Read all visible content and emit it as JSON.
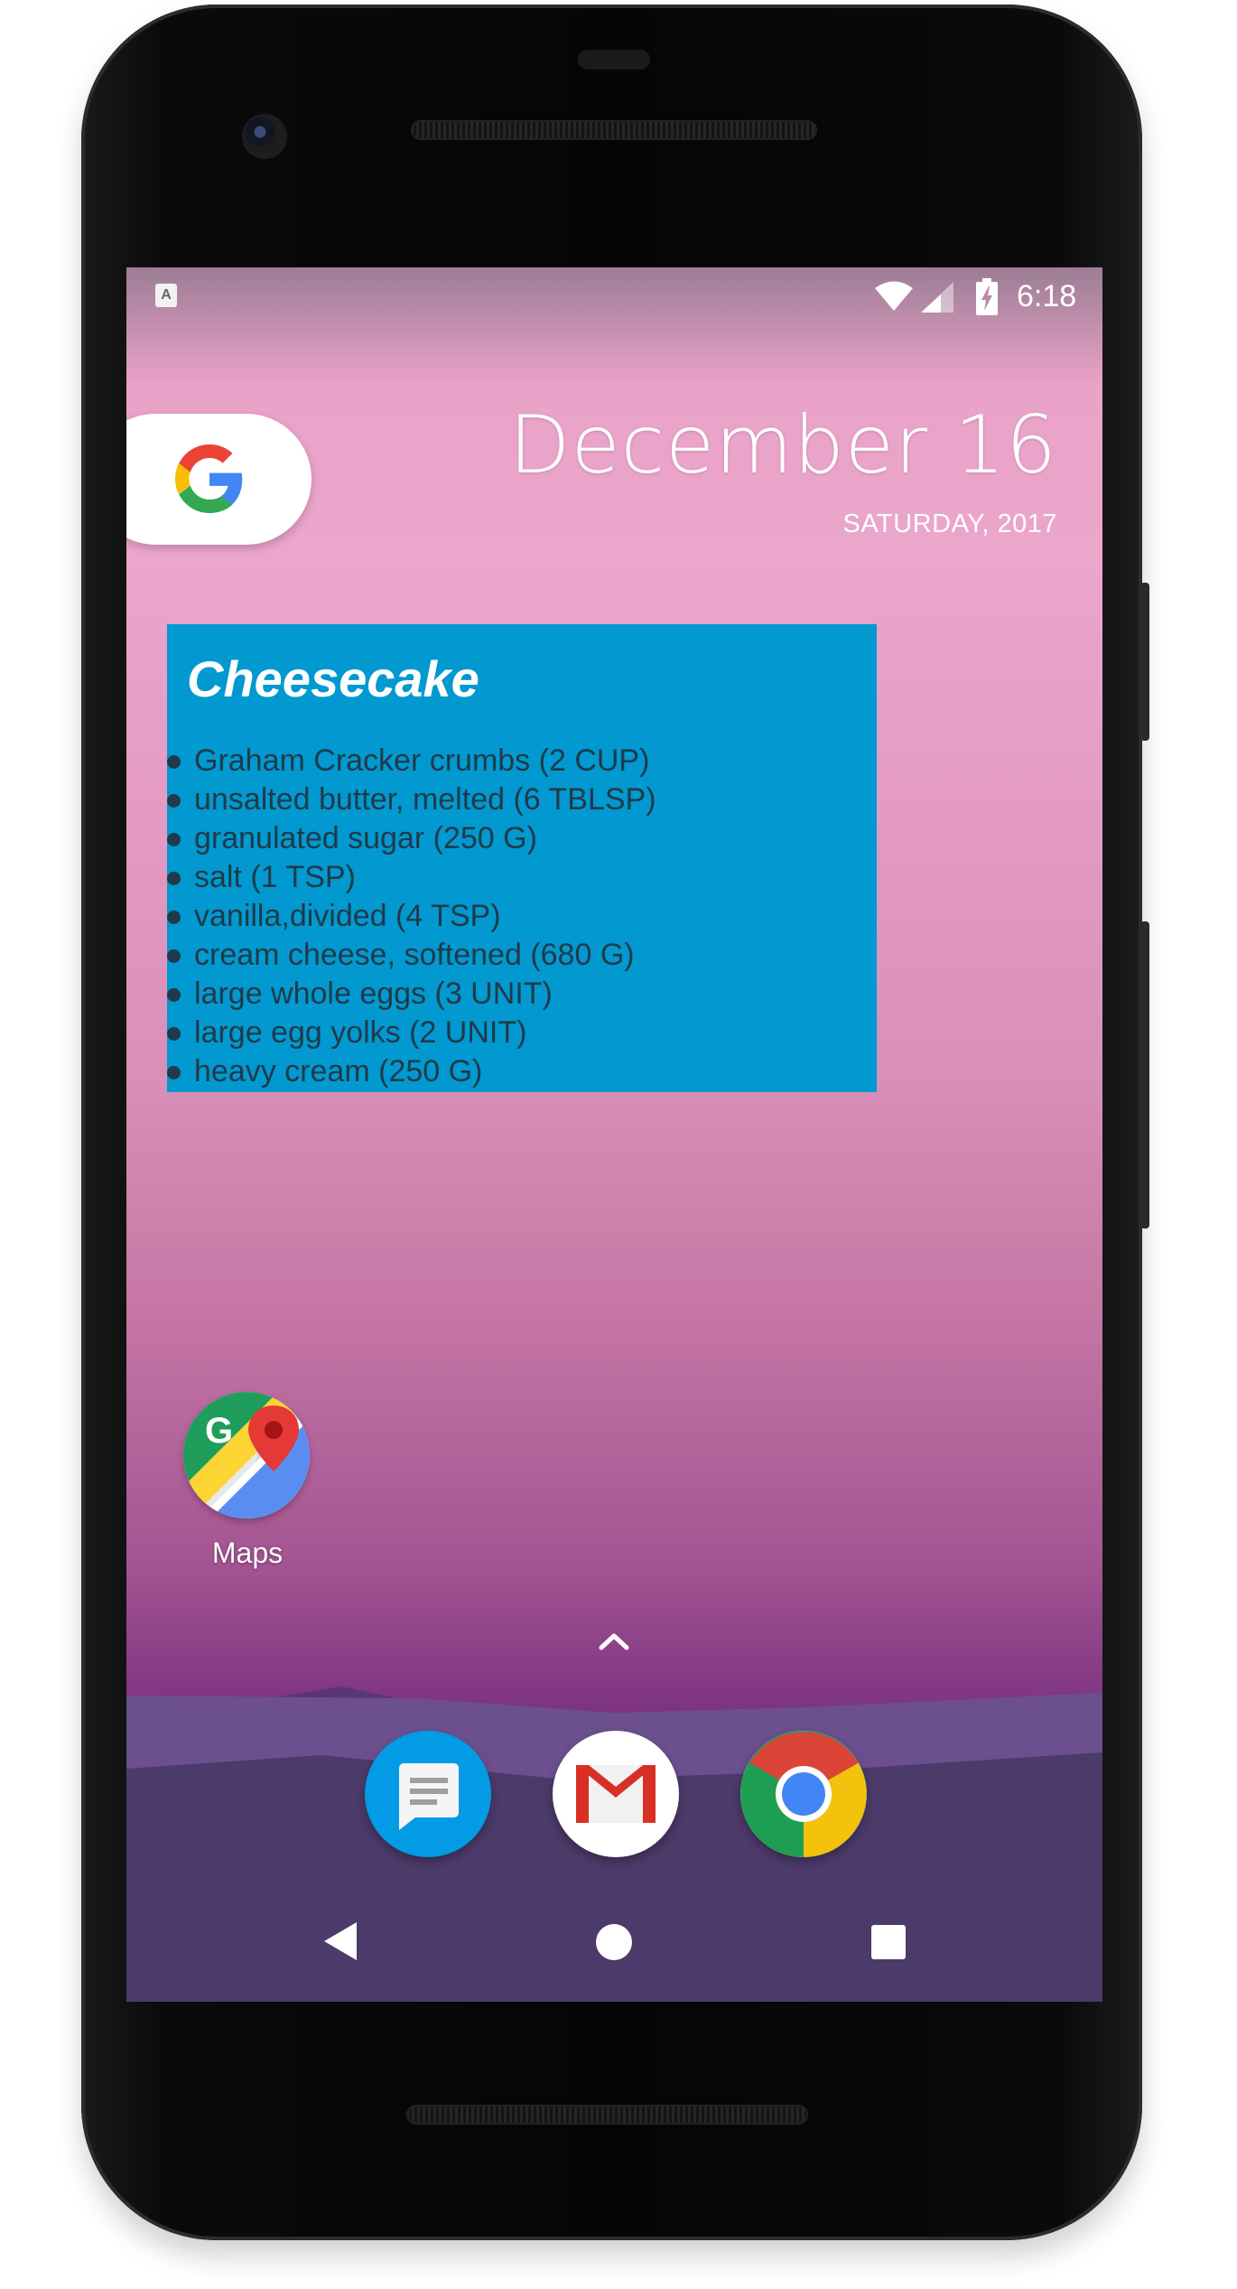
{
  "status_bar": {
    "notification_icon": "A",
    "icons": [
      "wifi-icon",
      "signal-icon",
      "battery-charging-icon"
    ],
    "time": "6:18"
  },
  "search_widget": {
    "icon": "google-g-icon"
  },
  "date_widget": {
    "date": "December 16",
    "weekday_year": "SATURDAY, 2017"
  },
  "recipe_widget": {
    "title": "Cheesecake",
    "background_color": "#0199cf",
    "ingredients": [
      "Graham Cracker crumbs (2 CUP)",
      "unsalted butter, melted (6 TBLSP)",
      "granulated sugar (250 G)",
      "salt (1 TSP)",
      "vanilla,divided (4 TSP)",
      "cream cheese, softened (680 G)",
      "large whole eggs (3 UNIT)",
      "large egg yolks (2 UNIT)",
      "heavy cream (250 G)"
    ]
  },
  "home_apps": [
    {
      "label": "Maps",
      "icon": "google-maps-icon"
    }
  ],
  "dock": {
    "apps": [
      "messages-icon",
      "gmail-icon",
      "chrome-icon"
    ]
  },
  "nav_bar": {
    "buttons": [
      "back-button",
      "home-button",
      "recents-button"
    ]
  }
}
